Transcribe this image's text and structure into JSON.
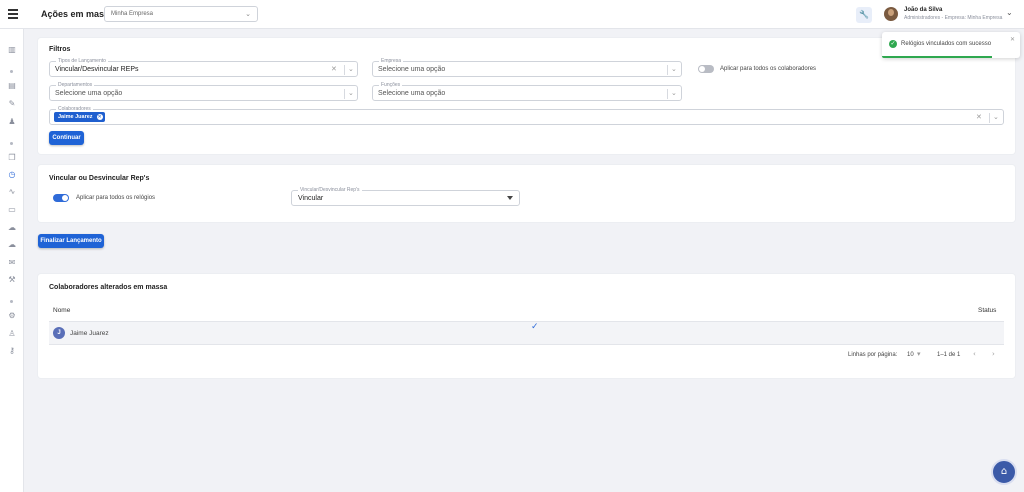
{
  "header": {
    "title": "Ações em massa",
    "company_select": "Minha Empresa",
    "user_name": "João da Silva",
    "user_role": "Administradores - Empresa: Minha Empresa"
  },
  "filters": {
    "title": "Filtros",
    "tipo_lancamento": {
      "label": "Tipos de Lançamento",
      "value": "Vincular/Desvincular REPs"
    },
    "empresa": {
      "label": "Empresa",
      "placeholder": "Selecione uma opção"
    },
    "aplicar_todos_colaboradores": {
      "label": "Aplicar para todos os colaboradores",
      "on": false
    },
    "departamentos": {
      "label": "Departamentos",
      "placeholder": "Selecione uma opção"
    },
    "funcoes": {
      "label": "Funções",
      "placeholder": "Selecione uma opção"
    },
    "colaboradores": {
      "label": "Colaboradores",
      "chips": [
        "Jaime Juarez"
      ]
    },
    "continue_label": "Continuar"
  },
  "vincular": {
    "title": "Vincular ou Desvincular Rep's",
    "aplicar_todos_relogios": {
      "label": "Aplicar para todos os relógios",
      "on": true
    },
    "select": {
      "label": "Vincular/Desvincular Rep's",
      "value": "Vincular"
    }
  },
  "finalizar_label": "Finalizar Lançamento",
  "table": {
    "title": "Colaboradores alterados em massa",
    "columns": [
      "Nome",
      "Status"
    ],
    "rows": [
      {
        "initial": "J",
        "name": "Jaime Juarez",
        "status": "check-icon"
      }
    ],
    "rows_per_page_label": "Linhas por página:",
    "rows_per_page": "10",
    "range": "1–1 de 1"
  },
  "toast": {
    "message": "Relógios vinculados com sucesso",
    "progress_fraction": 0.8
  },
  "colors": {
    "primary": "#1f63d6",
    "success": "#2fa84f",
    "background": "#f1f2f6"
  },
  "icons": {
    "sidebar": [
      "chart-icon",
      "document-icon",
      "edit-icon",
      "user-icon",
      "files-icon",
      "clock-icon",
      "trend-icon",
      "chat-icon",
      "cloud-icon",
      "cloud-upload-icon",
      "mail-icon",
      "wrench-icon",
      "gear-icon",
      "person-icon",
      "key-icon"
    ]
  }
}
